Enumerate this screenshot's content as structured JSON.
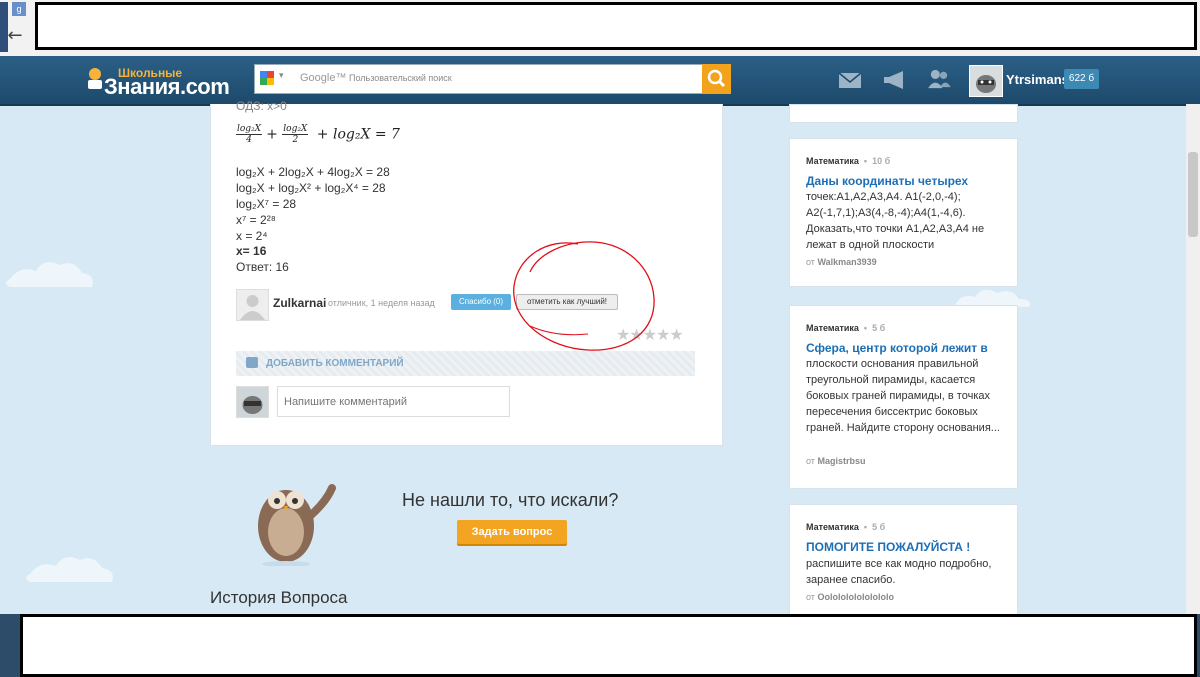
{
  "browser": {
    "back_glyph": "←",
    "tab_favicon": "g"
  },
  "header": {
    "logo_small": "Школьные",
    "logo_big": "Знания.com",
    "search_brand": "Google™",
    "search_placeholder": "Пользовательский поиск",
    "username": "Ytrsimans",
    "points": "622 б",
    "icons": [
      "mail-icon",
      "megaphone-icon",
      "friends-icon"
    ]
  },
  "answer": {
    "odz": "ОДЗ: x>0",
    "formula": {
      "num1": "log₂X",
      "den1": "4",
      "num2": "log₂X",
      "den2": "2",
      "tail": "+ log₂X = 7"
    },
    "lines": [
      "log₂X + 2log₂X + 4log₂X = 28",
      "log₂X  + log₂X² + log₂X⁴ = 28",
      "log₂X⁷ = 28",
      "x⁷ = 2²⁸",
      "x = 2⁴"
    ],
    "bold_line": "x= 16",
    "result": "Ответ: 16",
    "author": "Zulkarnai",
    "author_meta": "отличник, 1 неделя назад",
    "thanks_label": "Спасибо (0)",
    "best_label": "отметить как лучший!",
    "stars": "★★★★★",
    "rating": 0
  },
  "comments": {
    "add_label": "ДОБАВИТЬ КОММЕНТАРИЙ",
    "placeholder": "Напишите комментарий"
  },
  "notfound": {
    "text": "Не нашли то, что искали?",
    "button": "Задать вопрос"
  },
  "history": {
    "title": "История Вопроса"
  },
  "sidebar": [
    {
      "subject": "Математика",
      "points": "10 б",
      "title": "Даны координаты четырех",
      "body": "точек:A1,A2,A3,A4. A1(-2,0,-4); A2(-1,7,1);A3(4,-8,-4);A4(1,-4,6). Доказать,что точки A1,A2,A3,A4 не лежат в одной плоскости",
      "from_prefix": "от",
      "from": "Walkman3939"
    },
    {
      "subject": "Математика",
      "points": "5 б",
      "title": "Сфера, центр которой лежит в",
      "body": "плоскости основания правильной треугольной пирамиды, касается боковых граней пирамиды, в точках пересечения биссектрис боковых граней. Найдите сторону основания...",
      "from_prefix": "от",
      "from": "Magistrbsu"
    },
    {
      "subject": "Математика",
      "points": "5 б",
      "title": "ПОМОГИТЕ ПОЖАЛУЙСТА !",
      "body": "распишите все как модно подробно, заранее спасибо.",
      "from_prefix": "от",
      "from": "Oololololololololo"
    }
  ],
  "colors": {
    "accent": "#f3a420",
    "link": "#1d6fb5",
    "header": "#1d4a6c",
    "annotation": "#e0101a"
  }
}
